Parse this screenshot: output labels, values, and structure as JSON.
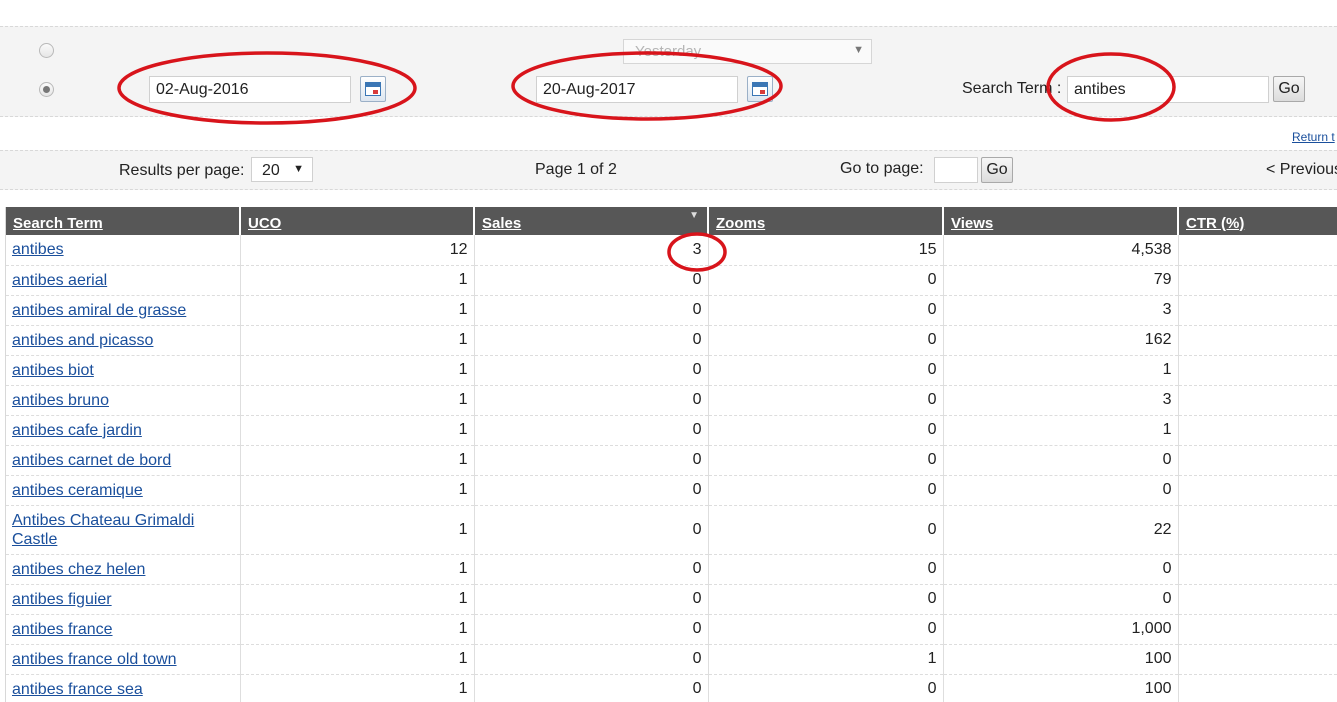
{
  "filters": {
    "preset_range": "Yesterday",
    "start_date": "02-Aug-2016",
    "end_date": "20-Aug-2017",
    "search_term_label": "Search Term :",
    "search_term_value": "antibes",
    "go_label": "Go"
  },
  "return_link": "Return t",
  "pager": {
    "results_per_page_label": "Results per page:",
    "results_per_page_value": "20",
    "page_info": "Page 1 of 2",
    "go_to_page_label": "Go to page:",
    "go_label": "Go",
    "previous_label": "< Previous"
  },
  "table": {
    "columns": [
      "Search Term",
      "UCO",
      "Sales",
      "Zooms",
      "Views",
      "CTR (%)"
    ],
    "rows": [
      {
        "term": "antibes",
        "uco": "12",
        "sales": "3",
        "zooms": "15",
        "views": "4,538"
      },
      {
        "term": "antibes aerial",
        "uco": "1",
        "sales": "0",
        "zooms": "0",
        "views": "79"
      },
      {
        "term": "antibes amiral de grasse",
        "uco": "1",
        "sales": "0",
        "zooms": "0",
        "views": "3"
      },
      {
        "term": "antibes and picasso",
        "uco": "1",
        "sales": "0",
        "zooms": "0",
        "views": "162"
      },
      {
        "term": "antibes biot",
        "uco": "1",
        "sales": "0",
        "zooms": "0",
        "views": "1"
      },
      {
        "term": "antibes bruno",
        "uco": "1",
        "sales": "0",
        "zooms": "0",
        "views": "3"
      },
      {
        "term": "antibes cafe jardin",
        "uco": "1",
        "sales": "0",
        "zooms": "0",
        "views": "1"
      },
      {
        "term": "antibes carnet de bord",
        "uco": "1",
        "sales": "0",
        "zooms": "0",
        "views": "0"
      },
      {
        "term": "antibes ceramique",
        "uco": "1",
        "sales": "0",
        "zooms": "0",
        "views": "0"
      },
      {
        "term": "Antibes Chateau Grimaldi Castle",
        "uco": "1",
        "sales": "0",
        "zooms": "0",
        "views": "22"
      },
      {
        "term": "antibes chez helen",
        "uco": "1",
        "sales": "0",
        "zooms": "0",
        "views": "0"
      },
      {
        "term": "antibes figuier",
        "uco": "1",
        "sales": "0",
        "zooms": "0",
        "views": "0"
      },
      {
        "term": "antibes france",
        "uco": "1",
        "sales": "0",
        "zooms": "0",
        "views": "1,000"
      },
      {
        "term": "antibes france old town",
        "uco": "1",
        "sales": "0",
        "zooms": "1",
        "views": "100"
      },
      {
        "term": "antibes france sea",
        "uco": "1",
        "sales": "0",
        "zooms": "0",
        "views": "100"
      }
    ]
  },
  "colors": {
    "header_bg": "#575757",
    "link": "#1a4f9c",
    "annotation": "#d8141b"
  }
}
